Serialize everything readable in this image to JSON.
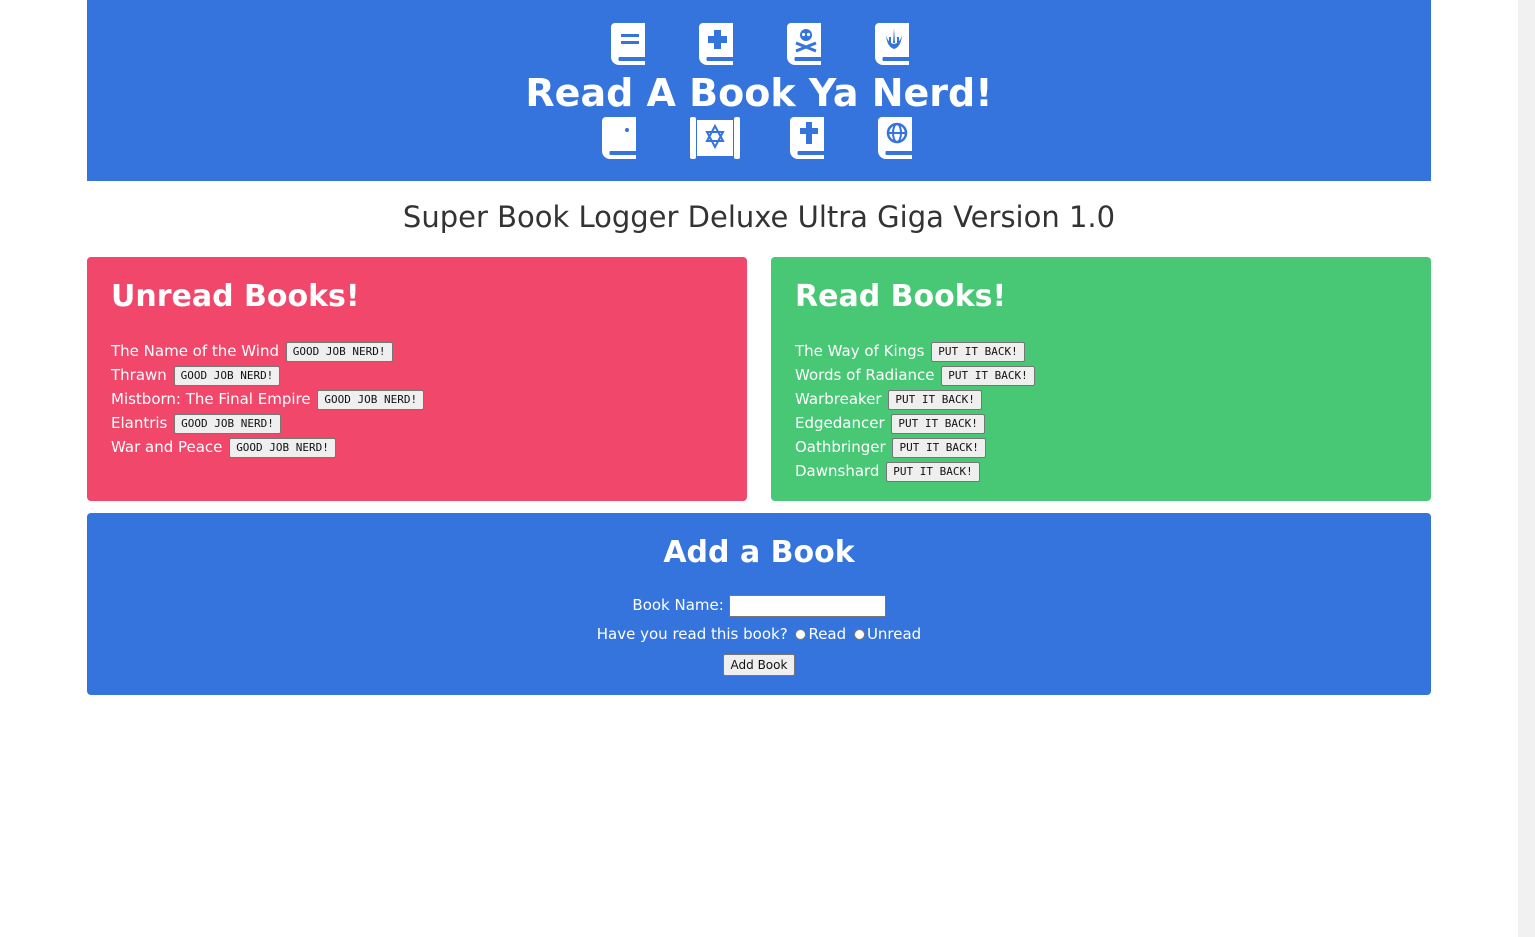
{
  "banner": {
    "title": "Read A Book Ya Nerd!",
    "top_icons": [
      "book-icon",
      "bible-plus-icon",
      "book-skull-icon",
      "book-jedi-icon"
    ],
    "bottom_icons": [
      "quran-icon",
      "torah-icon",
      "bible-cross-icon",
      "atlas-icon"
    ]
  },
  "subtitle": "Super Book Logger Deluxe Ultra Giga Version 1.0",
  "unread": {
    "heading": "Unread Books!",
    "button_label": "GOOD JOB NERD!",
    "books": [
      "The Name of the Wind",
      "Thrawn",
      "Mistborn: The Final Empire",
      "Elantris",
      "War and Peace"
    ]
  },
  "read": {
    "heading": "Read Books!",
    "button_label": "PUT IT BACK!",
    "books": [
      "The Way of Kings",
      "Words of Radiance",
      "Warbreaker",
      "Edgedancer",
      "Oathbringer",
      "Dawnshard"
    ]
  },
  "add_book": {
    "heading": "Add a Book",
    "name_label": "Book Name:",
    "name_value": "",
    "question": "Have you read this book?",
    "option_read": "Read",
    "option_unread": "Unread",
    "submit_label": "Add Book"
  },
  "colors": {
    "blue": "#3474dc",
    "red": "#f0476a",
    "green": "#48c774"
  }
}
